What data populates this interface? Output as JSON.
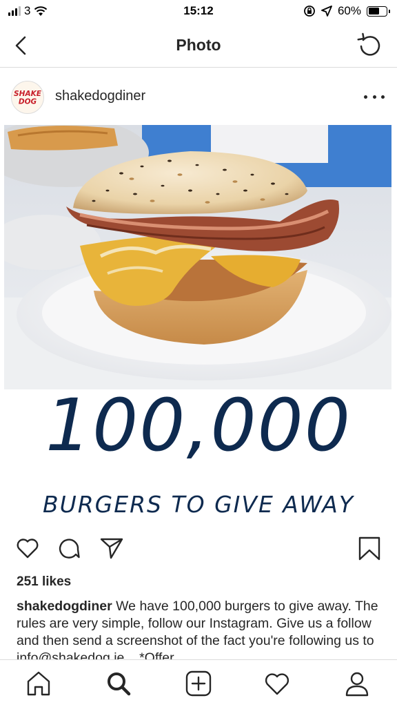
{
  "status_bar": {
    "carrier": "3",
    "time": "15:12",
    "battery_percent": "60%",
    "battery_level": 0.6
  },
  "nav": {
    "title": "Photo",
    "back_icon": "chevron-left-icon",
    "refresh_icon": "refresh-icon"
  },
  "post": {
    "username": "shakedogdiner",
    "avatar_text_line1": "SHAKE",
    "avatar_text_line2": "DOG",
    "promo_number": "100,000",
    "promo_tagline": "BURGERS TO GIVE AWAY",
    "likes": "251 likes",
    "caption_username": "shakedogdiner",
    "caption_text": "We have 100,000 burgers to give away. The rules are very simple, follow our Instagram. Give us a follow and then send a screenshot of the fact you're following us to info@shakedog.ie ...*Offer"
  },
  "actions": {
    "like_icon": "heart-icon",
    "comment_icon": "comment-icon",
    "share_icon": "send-icon",
    "save_icon": "bookmark-icon"
  },
  "tab_bar": {
    "items": [
      "home-icon",
      "search-icon",
      "add-icon",
      "activity-icon",
      "profile-icon"
    ]
  },
  "colors": {
    "promo_text": "#0e2a4f",
    "avatar_red": "#c8202b"
  }
}
